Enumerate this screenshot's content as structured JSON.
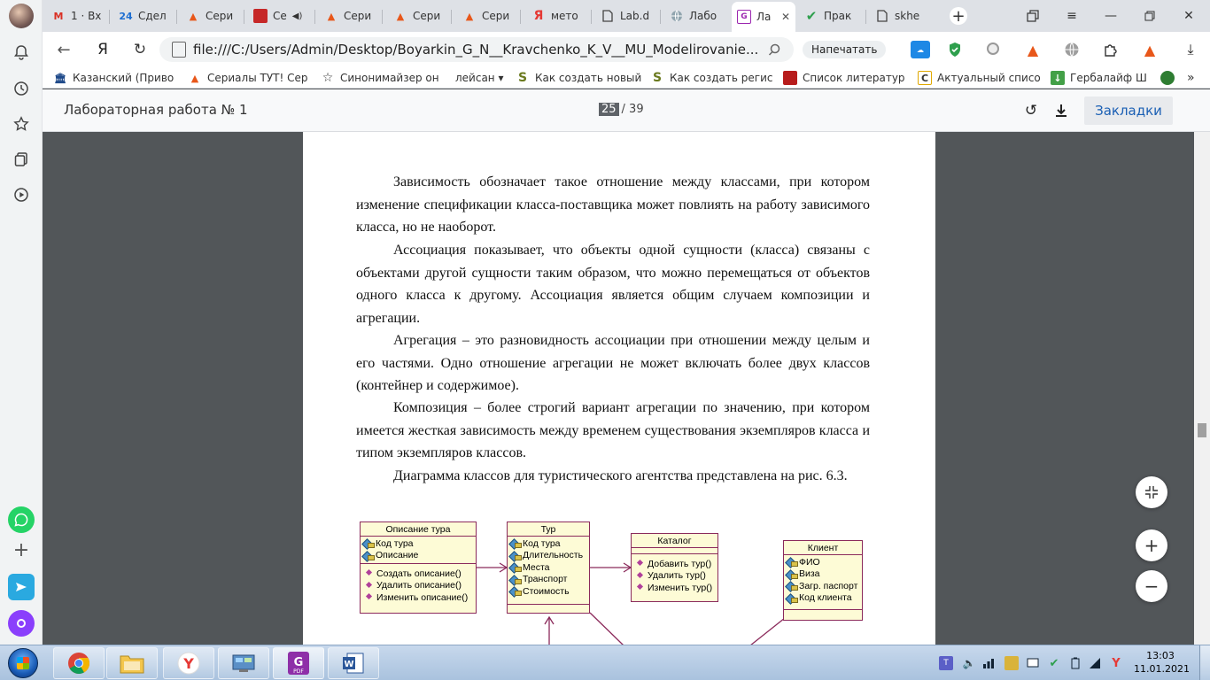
{
  "browser": {
    "tabs": [
      {
        "title": "1 · Вх",
        "icon": "gmail-icon",
        "color": "#d93025"
      },
      {
        "title": "Сдел",
        "icon": "24-icon",
        "color": "#1f6fd1"
      },
      {
        "title": "Сери",
        "icon": "fox-icon",
        "color": "#e8571a"
      },
      {
        "title": "Се",
        "icon": "red-book-icon",
        "color": "#c62828"
      },
      {
        "title": "Сери",
        "icon": "fox-icon",
        "color": "#e8571a"
      },
      {
        "title": "Сери",
        "icon": "fox-icon",
        "color": "#e8571a"
      },
      {
        "title": "Сери",
        "icon": "fox-icon",
        "color": "#e8571a"
      },
      {
        "title": "мето",
        "icon": "yandex-icon",
        "color": "#e53935"
      },
      {
        "title": "Lab.d",
        "icon": "doc-icon",
        "color": "#1a73e8"
      },
      {
        "title": "Лабо",
        "icon": "globe-icon",
        "color": "#607d8b"
      },
      {
        "title": "Ла",
        "icon": "pdf-tab-icon",
        "color": "#9c27b0"
      },
      {
        "title": "Прак",
        "icon": "check-icon",
        "color": "#2e9f4d"
      },
      {
        "title": "skhe",
        "icon": "file-icon",
        "color": "#555555"
      }
    ],
    "address": "file:///C:/Users/Admin/Desktop/Boyarkin_G_N__Kravchenko_K_V__MU_Modelirovanie...",
    "print_label": "Напечатать",
    "yandex_glyph": "Я",
    "bookmarks": [
      {
        "label": "Казанский (Приво",
        "icon": "bank-icon",
        "color": "#1f4a8a"
      },
      {
        "label": "Сериалы ТУТ! Сер",
        "icon": "fox-icon",
        "color": "#e8571a"
      },
      {
        "label": "Синонимайзер он",
        "icon": "star-icon",
        "color": "#333333"
      },
      {
        "label": "лейсан ▾",
        "icon": "",
        "color": "#333333"
      },
      {
        "label": "Как создать новый",
        "icon": "s-icon",
        "color": "#6b7a1f"
      },
      {
        "label": "Как создать регис",
        "icon": "s-icon",
        "color": "#6b7a1f"
      },
      {
        "label": "Список литератур",
        "icon": "book-icon",
        "color": "#b71c1c"
      },
      {
        "label": "Актуальный списо",
        "icon": "c-icon",
        "color": "#e0a800"
      },
      {
        "label": "Гербалайф Ш",
        "icon": "arrow-icon",
        "color": "#43a047"
      }
    ]
  },
  "pdf": {
    "title": "Лабораторная работа № 1",
    "page_current": "25",
    "page_total": "/ 39",
    "bookmarks_label": "Закладки",
    "paragraphs": [
      "Зависимость обозначает такое отношение между классами, при котором изменение спецификации класса-поставщика может повлиять на работу зависимого класса, но не наоборот.",
      "Ассоциация показывает, что объекты одной сущности (класса) связаны с объектами другой сущности таким образом, что можно перемещаться от объектов одного класса к другому. Ассоциация является общим случаем композиции и агрегации.",
      "Агрегация – это разновидность ассоциации при отношении между целым и его частями. Одно отношение агрегации не может включать более двух классов (контейнер и содержимое).",
      "Композиция – более строгий вариант агрегации по значению, при котором имеется жесткая зависимость между временем существования экземпляров класса и типом экземпляров классов.",
      "Диаграмма классов для туристического агентства представлена на рис. 6.3."
    ],
    "diagram": {
      "classes": [
        {
          "name": "Описание тура",
          "attributes": [
            "Код тура",
            "Описание"
          ],
          "operations": [
            "Создать описание()",
            "Удалить описание()",
            "Изменить описание()"
          ]
        },
        {
          "name": "Тур",
          "attributes": [
            "Код тура",
            "Длительность",
            "Места",
            "Транспорт",
            "Стоимость"
          ],
          "operations": []
        },
        {
          "name": "Каталог",
          "attributes": [],
          "operations": [
            "Добавить тур()",
            "Удалить тур()",
            "Изменить тур()"
          ]
        },
        {
          "name": "Клиент",
          "attributes": [
            "ФИО",
            "Виза",
            "Загр. паспорт",
            "Код клиента"
          ],
          "operations": []
        }
      ]
    }
  },
  "taskbar": {
    "apps": [
      "chrome",
      "explorer",
      "yandex",
      "control-panel",
      "pdf-app",
      "word"
    ],
    "clock_time": "13:03",
    "clock_date": "11.01.2021"
  },
  "colors": {
    "uml_border": "#8b2a5b",
    "uml_fill": "#fdfbd6",
    "accent": "#1a73e8"
  }
}
